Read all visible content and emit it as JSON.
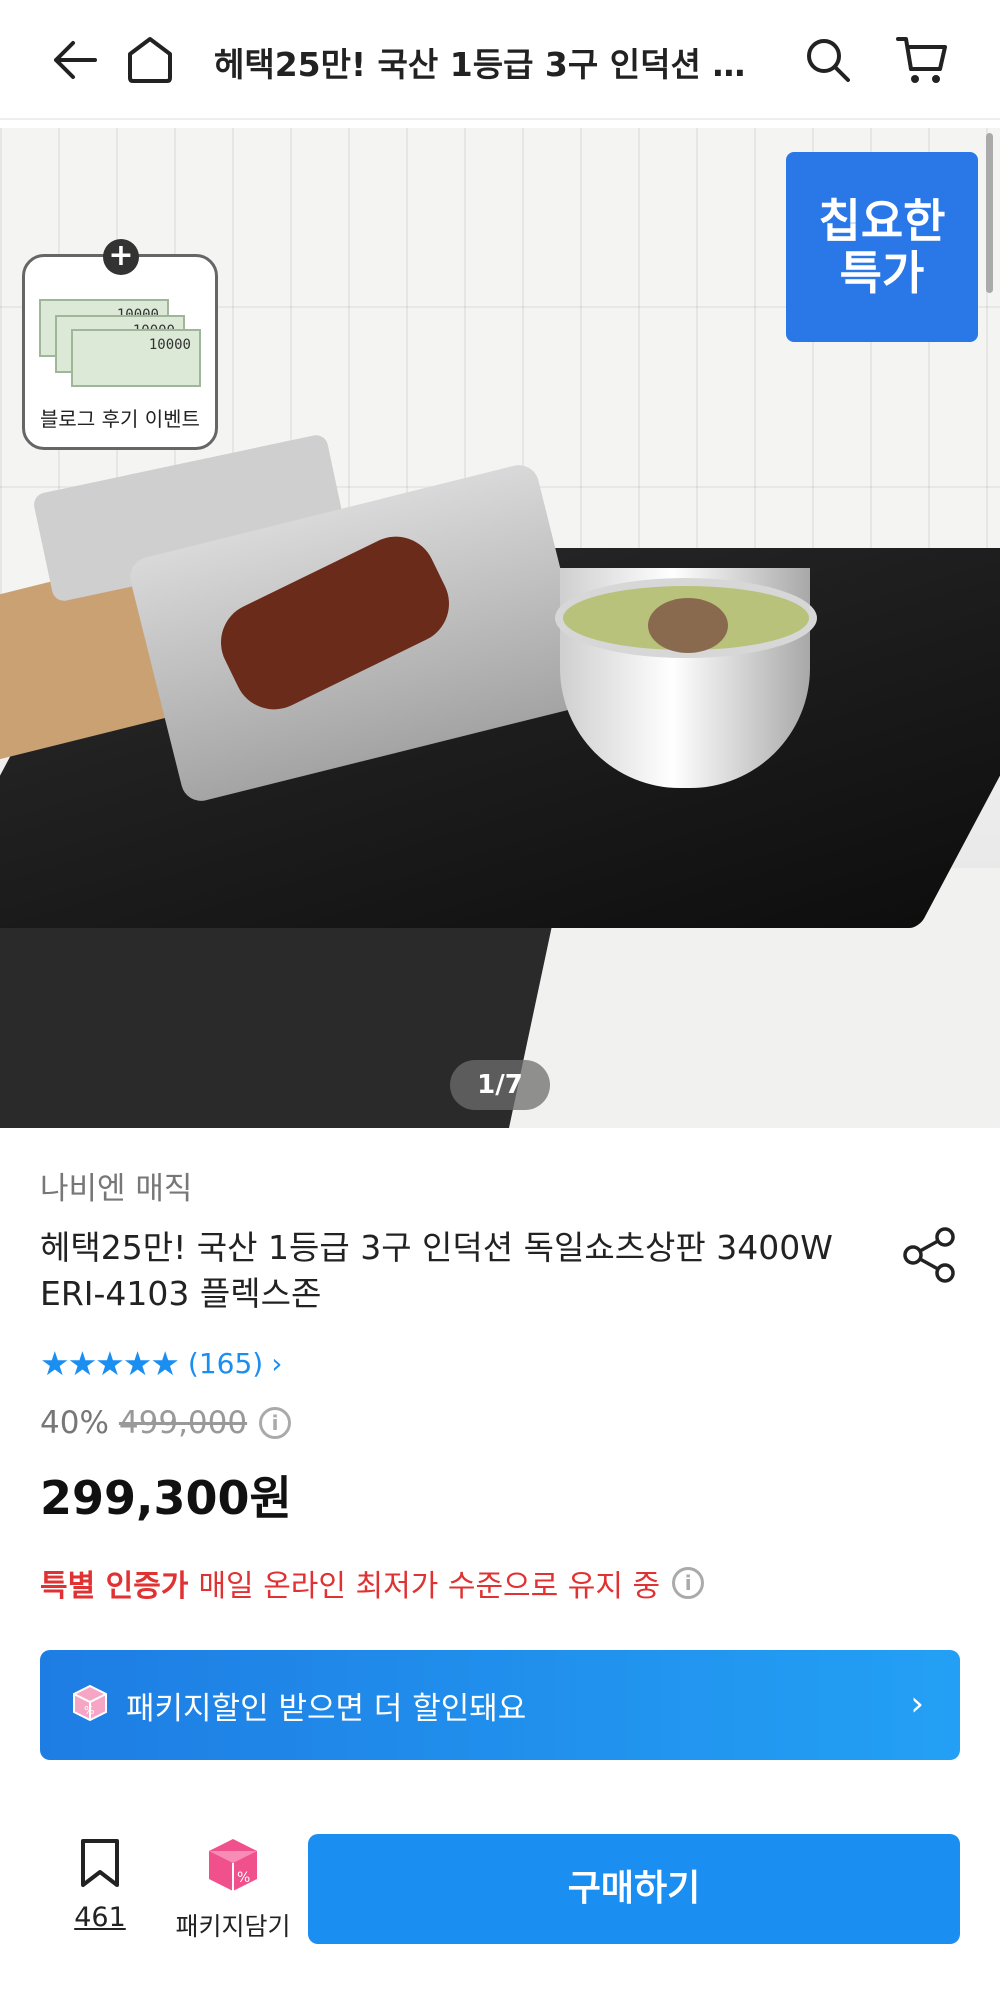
{
  "header": {
    "title": "헤택25만! 국산 1등급 3구 인덕션 독일쇼츠상판 3400W ERI-4103 플렉스존",
    "back_icon": "arrow-left-icon",
    "home_icon": "home-icon",
    "search_icon": "search-icon",
    "cart_icon": "cart-icon"
  },
  "gallery": {
    "promo_badge": "칩요한\n특가",
    "event_label": "블로그 후기 이벤트",
    "bill_values": [
      "10000",
      "10000",
      "10000"
    ],
    "pager": "1/7"
  },
  "product": {
    "brand": "나비엔 매직",
    "title": "헤택25만! 국산 1등급 3구 인덕션 독일쇼츠상판 3400W ERI-4103 플렉스존",
    "rating_stars": 5,
    "review_count": "(165)",
    "discount_rate": "40%",
    "original_price": "499,000",
    "price": "299,300원",
    "special_label": "특별 인증가",
    "special_text": "매일 온라인 최저가 수준으로 유지 중"
  },
  "package_banner": {
    "text": "패키지할인 받으면 더 할인돼요"
  },
  "bottom_bar": {
    "bookmark_count": "461",
    "package_cart_label": "패키지담기",
    "buy_label": "구매하기"
  },
  "colors": {
    "accent": "#1b8ef2",
    "promo": "#2a78e8",
    "special": "#e03232",
    "package_icon": "#f0508c"
  }
}
